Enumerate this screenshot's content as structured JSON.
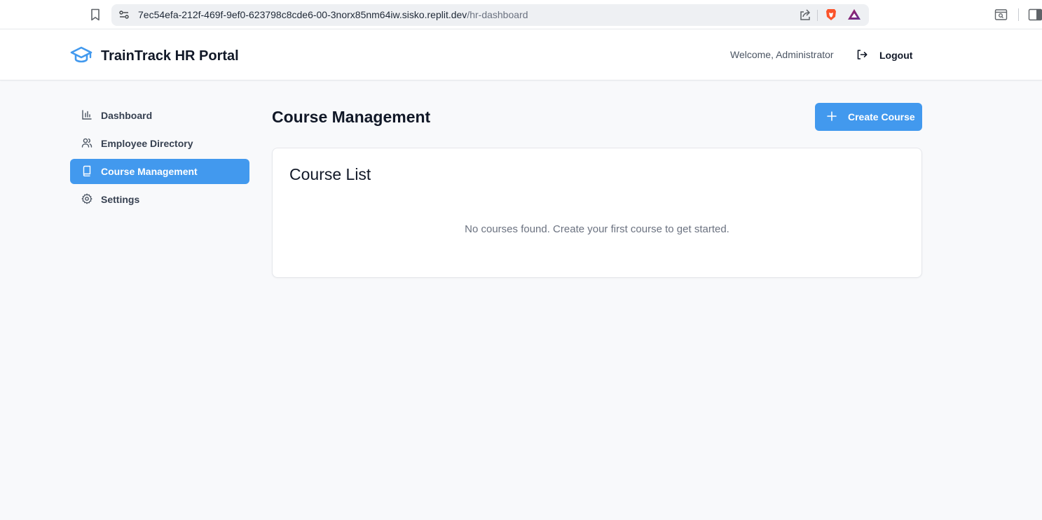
{
  "browser": {
    "url_host": "7ec54efa-212f-469f-9ef0-623798c8cde6-00-3norx85nm64iw.sisko.replit.dev",
    "url_path": "/hr-dashboard"
  },
  "header": {
    "brand_title": "TrainTrack HR Portal",
    "welcome_text": "Welcome, Administrator",
    "logout_label": "Logout"
  },
  "sidebar": {
    "items": [
      {
        "label": "Dashboard",
        "icon": "bar-chart-icon",
        "active": false
      },
      {
        "label": "Employee Directory",
        "icon": "users-icon",
        "active": false
      },
      {
        "label": "Course Management",
        "icon": "book-icon",
        "active": true
      },
      {
        "label": "Settings",
        "icon": "gear-icon",
        "active": false
      }
    ]
  },
  "main": {
    "page_title": "Course Management",
    "create_button_label": "Create Course",
    "card_title": "Course List",
    "empty_message": "No courses found. Create your first course to get started."
  },
  "colors": {
    "accent": "#4299ee",
    "background": "#f8f9fb",
    "text_primary": "#111827",
    "text_muted": "#6b7280"
  }
}
